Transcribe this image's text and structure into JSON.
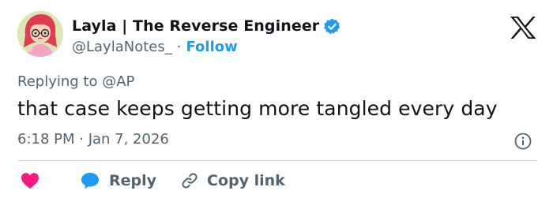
{
  "author": {
    "name": "Layla | The Reverse Engineer",
    "handle": "@LaylaNotes_",
    "separator": "·",
    "follow_label": "Follow",
    "verified_icon": "verified-badge-icon",
    "avatar": "cartoon-avatar"
  },
  "platform": {
    "logo": "x-logo-icon"
  },
  "tweet": {
    "reply_prefix": "Replying to ",
    "reply_mention": "@AP",
    "text": "that case keeps getting more tangled every day",
    "timestamp": "6:18 PM · Jan 7, 2026"
  },
  "actions": {
    "like_icon": "heart-icon",
    "reply_icon": "reply-bubble-icon",
    "reply_label": "Reply",
    "copy_icon": "link-icon",
    "copy_label": "Copy link",
    "info_icon": "info-icon"
  },
  "colors": {
    "accent": "#1d9bf0",
    "like": "#f91880",
    "text_primary": "#0f1419",
    "text_secondary": "#536471",
    "divider": "#cfd9de"
  }
}
